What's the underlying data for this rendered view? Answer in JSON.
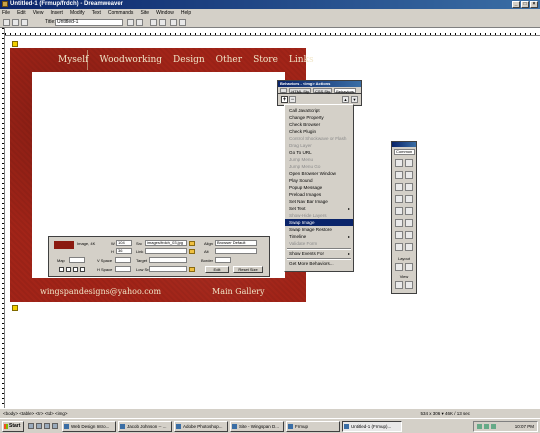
{
  "window": {
    "title": "Untitled-1 (Frmup/frdch) - Dreamweaver",
    "buttons": [
      "_",
      "□",
      "×"
    ]
  },
  "menubar": [
    "File",
    "Edit",
    "View",
    "Insert",
    "Modify",
    "Text",
    "Commands",
    "Site",
    "Window",
    "Help"
  ],
  "toolbar": {
    "title_label": "Title:",
    "title_value": "Untitled-1"
  },
  "site": {
    "nav": [
      "Myself",
      "Woodworking",
      "Design",
      "Other",
      "Store",
      "Links"
    ],
    "footer_email": "wingspandesigns@yahoo.com",
    "footer_gallery": "Main Gallery",
    "accent_color": "#a22418"
  },
  "properties": {
    "image_label": "Image, 4K",
    "w_label": "W",
    "w_value": "104",
    "h_label": "H",
    "h_value": "36",
    "src_label": "Src",
    "src_value": "images/frdch_03.jpg",
    "link_label": "Link",
    "link_value": "",
    "align_label": "Align",
    "align_value": "Browser Default",
    "alt_label": "Alt",
    "alt_value": "",
    "map_label": "Map",
    "vspace_label": "V Space",
    "target_label": "Target",
    "border_label": "Border",
    "hspace_label": "H Space",
    "lowsrc_label": "Low Src",
    "edit_label": "Edit",
    "reset_label": "Reset Size"
  },
  "behaviors": {
    "title": "Behaviors - <img> Actions",
    "tabs": [
      "...",
      "HTML Sty",
      "CSS Sty",
      "Behaviors"
    ],
    "plus": "+",
    "minus": "−",
    "up": "▲",
    "down": "▼"
  },
  "actions_menu": [
    {
      "label": "Call JavaScript",
      "state": "normal"
    },
    {
      "label": "Change Property",
      "state": "normal"
    },
    {
      "label": "Check Browser",
      "state": "normal"
    },
    {
      "label": "Check Plugin",
      "state": "normal"
    },
    {
      "label": "Control Shockwave or Flash",
      "state": "disabled"
    },
    {
      "label": "Drag Layer",
      "state": "disabled"
    },
    {
      "label": "Go To URL",
      "state": "normal"
    },
    {
      "label": "Jump Menu",
      "state": "disabled"
    },
    {
      "label": "Jump Menu Go",
      "state": "disabled"
    },
    {
      "label": "Open Browser Window",
      "state": "normal"
    },
    {
      "label": "Play Sound",
      "state": "normal"
    },
    {
      "label": "Popup Message",
      "state": "normal"
    },
    {
      "label": "Preload Images",
      "state": "normal"
    },
    {
      "label": "Set Nav Bar Image",
      "state": "normal"
    },
    {
      "label": "Set Text",
      "state": "normal",
      "submenu": true
    },
    {
      "label": "Show-Hide Layers",
      "state": "disabled"
    },
    {
      "label": "Swap Image",
      "state": "selected"
    },
    {
      "label": "Swap Image Restore",
      "state": "normal"
    },
    {
      "label": "Timeline",
      "state": "normal",
      "submenu": true
    },
    {
      "label": "Validate Form",
      "state": "disabled"
    },
    {
      "label": "Show Events For",
      "state": "normal",
      "submenu": true
    },
    {
      "label": "Get More Behaviors...",
      "state": "normal"
    }
  ],
  "objects_panel": {
    "category": "Common",
    "layout_label": "Layout",
    "view_label": "View"
  },
  "status": {
    "tag_selector": "<body> <table> <tr> <td> <img>",
    "size_info": "534 x 306 ▾ 46K / 13 sec"
  },
  "taskbar": {
    "start": "Start",
    "tasks": [
      "Web Design Intro...",
      "Jacob Johnson -- ...",
      "Adobe Photoshop...",
      "Site - Wingspan D...",
      "Frmup",
      "Untitled-1 (Frmup)..."
    ],
    "active_task": 5,
    "clock": "10:07 PM"
  }
}
